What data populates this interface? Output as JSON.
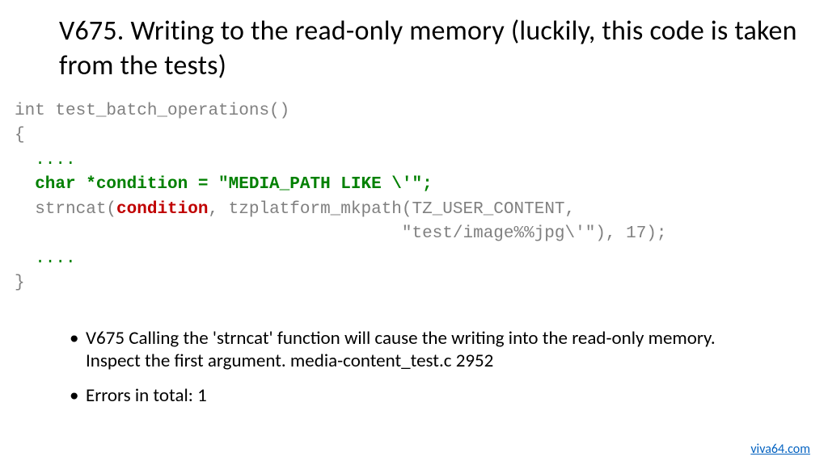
{
  "title": "V675. Writing to the read-only memory (luckily, this code is taken from the tests)",
  "code": {
    "l1": "int test_batch_operations()",
    "l2": "{",
    "l3_dots": "  ....",
    "l4_a": "  char *condition = ",
    "l4_b": "\"MEDIA_PATH LIKE \\'\"",
    "l4_c": ";",
    "l5_a": "  strncat(",
    "l5_b": "condition",
    "l5_c": ", tzplatform_mkpath(TZ_USER_CONTENT,",
    "l6": "                                      \"test/image%%jpg\\'\"), 17);",
    "l7_dots": "  ....",
    "l8": "}"
  },
  "bullets": {
    "b1": "V675 Calling the 'strncat' function will cause the writing into the read-only memory. Inspect the first argument. media-content_test.c 2952",
    "b2": "Errors in total: 1"
  },
  "footer": {
    "link": "viva64.com"
  }
}
